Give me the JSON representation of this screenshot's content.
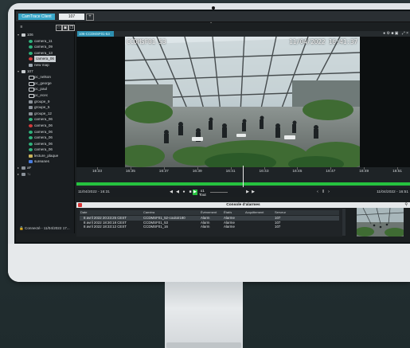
{
  "app": {
    "title": "CamTrace Client",
    "workspace_tab": "107",
    "add_tab": "+"
  },
  "sidebar": {
    "tools": [
      "≡",
      "□",
      "▣",
      "❐"
    ],
    "tree": [
      {
        "label": "106",
        "icon": "server",
        "level": 0,
        "expanded": true
      },
      {
        "label": "camera_11",
        "icon": "camera",
        "level": 1
      },
      {
        "label": "camera_09",
        "icon": "camera",
        "level": 1
      },
      {
        "label": "camera_13",
        "icon": "camera",
        "level": 1
      },
      {
        "label": "camera_06",
        "icon": "camera-red",
        "level": 1,
        "selected": true
      },
      {
        "label": "new map",
        "icon": "map",
        "level": 1
      },
      {
        "label": "107",
        "icon": "server",
        "level": 0,
        "expanded": true
      },
      {
        "label": "pc_nelson",
        "icon": "monitor",
        "level": 1
      },
      {
        "label": "pc_george",
        "icon": "monitor",
        "level": 1
      },
      {
        "label": "pc_paul",
        "icon": "monitor",
        "level": 1
      },
      {
        "label": "pc_ecec",
        "icon": "monitor",
        "level": 1
      },
      {
        "label": "groupe_9",
        "icon": "group",
        "level": 1
      },
      {
        "label": "groupe_5",
        "icon": "group",
        "level": 1
      },
      {
        "label": "groupe_12",
        "icon": "group",
        "level": 1
      },
      {
        "label": "camera_06",
        "icon": "camera",
        "level": 1
      },
      {
        "label": "camera_06",
        "icon": "camera-red",
        "level": 1
      },
      {
        "label": "camera_06",
        "icon": "camera",
        "level": 1
      },
      {
        "label": "camera_06",
        "icon": "camera",
        "level": 1
      },
      {
        "label": "camera_06",
        "icon": "camera",
        "level": 1
      },
      {
        "label": "camera_06",
        "icon": "camera",
        "level": 1
      },
      {
        "label": "lecture_plaque",
        "icon": "plate",
        "level": 1
      },
      {
        "label": "sureanes",
        "icon": "flag",
        "level": 1
      },
      {
        "label": "aF",
        "icon": "group",
        "level": 0
      },
      {
        "label": "↑↓",
        "icon": "group",
        "level": 0
      }
    ],
    "status": "Connecté - 11/04/2022 17..."
  },
  "viewer": {
    "title_tab": "106-CCDMSF01-53",
    "window_icons": "⤢ ×",
    "cam_icons": "● ⚙ ■ ▣",
    "osd_camera": "CCDMSF01-53",
    "osd_datetime": "11/04/2022 16:41:37"
  },
  "timeline": {
    "ticks": [
      "16:33",
      "16:35",
      "16:37",
      "16:39",
      "16:41",
      "16:43",
      "16:45",
      "16:47",
      "16:49",
      "16:51"
    ],
    "start": "11/04/2022 - 16:31",
    "end": "11/04/2022 - 16:51",
    "speed": "x1",
    "speed_label": "Tout",
    "colors": {
      "recording": "#26c23f",
      "accent": "#2d8fb0",
      "alarm": "#d83333"
    }
  },
  "console": {
    "title": "Console d'alarmes",
    "columns": [
      "Date",
      "Caméra",
      "Événement",
      "État/s",
      "Acquittement",
      "Serveur"
    ],
    "rows": [
      {
        "date": "8 avril 2022 20:23:25 CEST",
        "camera": "CCDMSF01_52-couloir180",
        "event": "Alarm",
        "state": "Alarme",
        "ack": "",
        "server": "107"
      },
      {
        "date": "8 avril 2022 18:30:18 CEST",
        "camera": "CCDMSF01_53",
        "event": "Alarm",
        "state": "Alarme",
        "ack": "",
        "server": "107"
      },
      {
        "date": "8 avril 2022 18:33:12 CEST",
        "camera": "CCDMSF01_16",
        "event": "Alarm",
        "state": "Alarme",
        "ack": "",
        "server": "107"
      }
    ]
  }
}
